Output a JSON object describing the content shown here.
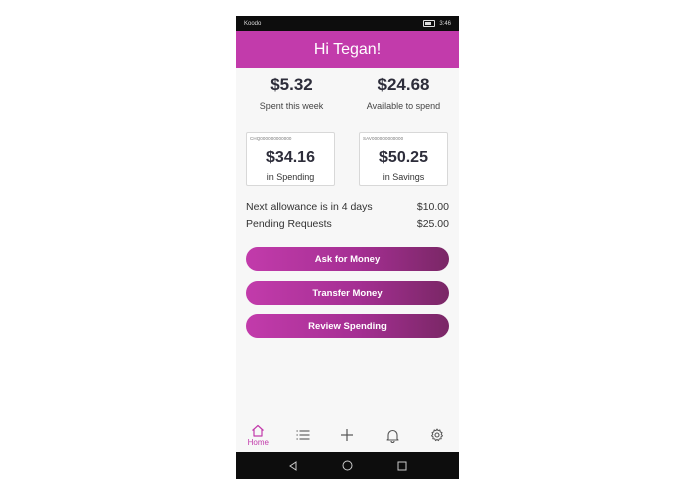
{
  "status_bar": {
    "carrier": "Koodo",
    "time": "3:46"
  },
  "header": {
    "greeting": "Hi Tegan!"
  },
  "summary": [
    {
      "amount": "$5.32",
      "label": "Spent this week"
    },
    {
      "amount": "$24.68",
      "label": "Available to spend"
    }
  ],
  "accounts": [
    {
      "number": "CHQ000000000000",
      "amount": "$34.16",
      "label": "in Spending"
    },
    {
      "number": "SAV000000000000",
      "amount": "$50.25",
      "label": "in Savings"
    }
  ],
  "info": [
    {
      "label": "Next allowance is in 4 days",
      "value": "$10.00"
    },
    {
      "label": "Pending Requests",
      "value": "$25.00"
    }
  ],
  "actions": {
    "ask": "Ask for Money",
    "transfer": "Transfer Money",
    "review": "Review Spending"
  },
  "bottom_nav": {
    "home_label": "Home",
    "items": [
      "home-icon",
      "list-icon",
      "plus-icon",
      "bell-icon",
      "gear-icon"
    ]
  },
  "colors": {
    "brand": "#c23bab",
    "brand_dark": "#7a2766",
    "text_dark": "#2d2d3a"
  }
}
